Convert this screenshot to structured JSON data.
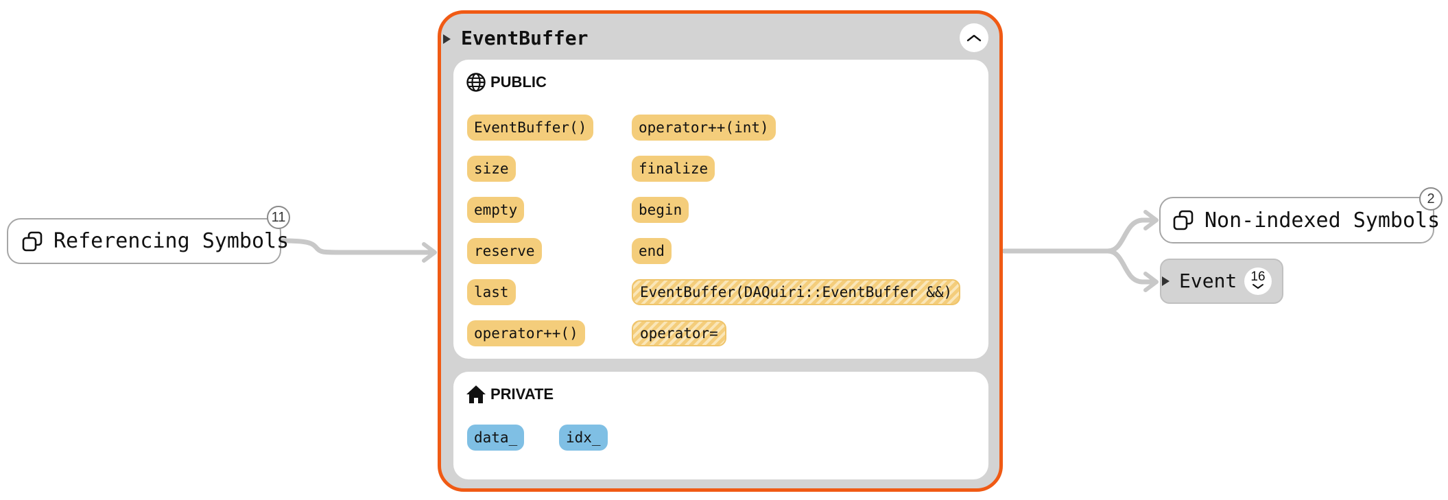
{
  "main_node": {
    "title": "EventBuffer",
    "collapse_icon": "chevron-up-icon",
    "border_color": "#f05a14"
  },
  "public_section": {
    "title": "PUBLIC",
    "icon": "globe-icon",
    "members_left": [
      "EventBuffer()",
      "size",
      "empty",
      "reserve",
      "last",
      "operator++()"
    ],
    "members_right": [
      "operator++(int)",
      "finalize",
      "begin",
      "end",
      "EventBuffer(DAQuiri::EventBuffer &&)",
      "operator="
    ]
  },
  "private_section": {
    "title": "PRIVATE",
    "icon": "home-icon",
    "members": [
      "data_",
      "idx_"
    ]
  },
  "referencing": {
    "label": "Referencing Symbols",
    "count": "11",
    "icon": "copy-icon"
  },
  "non_indexed": {
    "label": "Non-indexed Symbols",
    "count": "2",
    "icon": "copy-icon"
  },
  "event_node": {
    "label": "Event",
    "count": "16",
    "icon": "chevron-down-icon"
  },
  "colors": {
    "public_chip": "#f4cd7b",
    "private_chip": "#7fbfe4",
    "edge": "#c8c8c8",
    "node_bg": "#d3d3d3"
  }
}
